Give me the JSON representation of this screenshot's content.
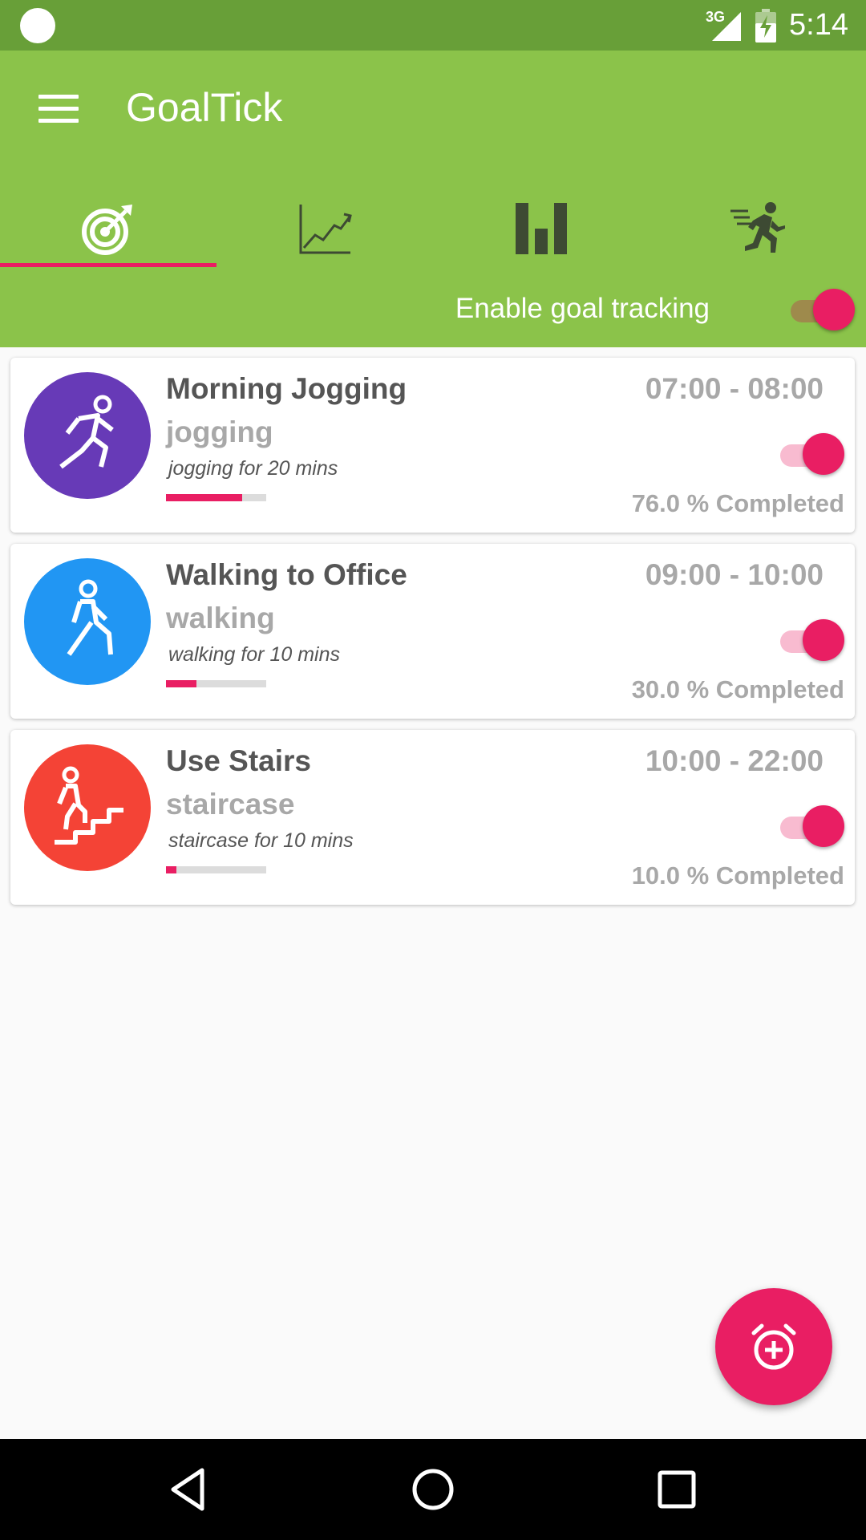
{
  "status_bar": {
    "network_label": "3G",
    "time": "5:14",
    "icons": [
      "notification-dot-icon",
      "signal-icon",
      "battery-charging-icon"
    ]
  },
  "app_bar": {
    "title": "GoalTick",
    "menu_icon": "hamburger-menu-icon",
    "tabs": [
      {
        "icon": "target-icon",
        "selected": true
      },
      {
        "icon": "line-chart-icon",
        "selected": false
      },
      {
        "icon": "bar-chart-icon",
        "selected": false
      },
      {
        "icon": "running-person-icon",
        "selected": false
      }
    ],
    "tracking_label": "Enable goal tracking",
    "tracking_enabled": true
  },
  "goals": [
    {
      "title": "Morning Jogging",
      "category": "jogging",
      "description": "jogging for 20 mins",
      "time": "07:00 - 08:00",
      "completed": "76.0 % Completed",
      "progress": 0.76,
      "enabled": true,
      "icon": "jogging-icon",
      "color": "#673ab7"
    },
    {
      "title": "Walking to Office",
      "category": "walking",
      "description": "walking for 10 mins",
      "time": "09:00 - 10:00",
      "completed": "30.0 % Completed",
      "progress": 0.3,
      "enabled": true,
      "icon": "walking-icon",
      "color": "#2196f3"
    },
    {
      "title": "Use Stairs",
      "category": "staircase",
      "description": "staircase for 10 mins",
      "time": "10:00 - 22:00",
      "completed": "10.0 % Completed",
      "progress": 0.1,
      "enabled": true,
      "icon": "stairs-icon",
      "color": "#f44336"
    }
  ],
  "fab": {
    "icon": "add-alarm-icon",
    "color": "#e91e63"
  },
  "nav_bar": {
    "icons": [
      "back-icon",
      "home-icon",
      "recents-icon"
    ]
  },
  "colors": {
    "status_bar": "#689f38",
    "app_bar": "#8bc34a",
    "accent": "#e91e63"
  }
}
